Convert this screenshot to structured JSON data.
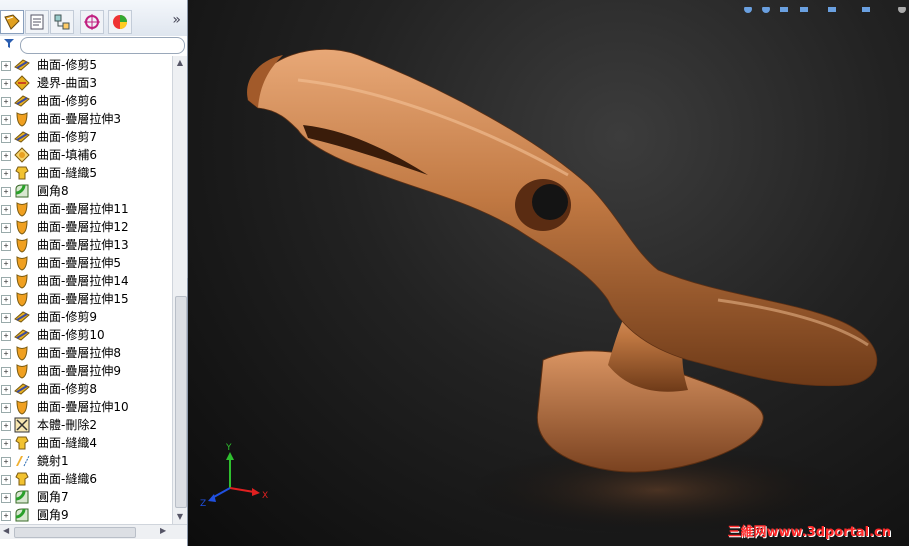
{
  "panel": {
    "tabs": [
      {
        "icon": "feature-manager-icon",
        "active": true
      },
      {
        "icon": "property-manager-icon"
      },
      {
        "icon": "configuration-manager-icon"
      },
      {
        "icon": "dimxpert-icon"
      },
      {
        "icon": "display-manager-icon"
      }
    ],
    "more_label": "»",
    "filter_icon": "filter-icon"
  },
  "tree": {
    "items": [
      {
        "label": "曲面-修剪5",
        "icon": "trim-surface-icon"
      },
      {
        "label": "邊界-曲面3",
        "icon": "boundary-surface-icon"
      },
      {
        "label": "曲面-修剪6",
        "icon": "trim-surface-icon"
      },
      {
        "label": "曲面-疊層拉伸3",
        "icon": "loft-surface-icon"
      },
      {
        "label": "曲面-修剪7",
        "icon": "trim-surface-icon"
      },
      {
        "label": "曲面-填補6",
        "icon": "fill-surface-icon"
      },
      {
        "label": "曲面-縫織5",
        "icon": "knit-surface-icon"
      },
      {
        "label": "圓角8",
        "icon": "fillet-icon"
      },
      {
        "label": "曲面-疊層拉伸11",
        "icon": "loft-surface-icon"
      },
      {
        "label": "曲面-疊層拉伸12",
        "icon": "loft-surface-icon"
      },
      {
        "label": "曲面-疊層拉伸13",
        "icon": "loft-surface-icon"
      },
      {
        "label": "曲面-疊層拉伸5",
        "icon": "loft-surface-icon"
      },
      {
        "label": "曲面-疊層拉伸14",
        "icon": "loft-surface-icon"
      },
      {
        "label": "曲面-疊層拉伸15",
        "icon": "loft-surface-icon"
      },
      {
        "label": "曲面-修剪9",
        "icon": "trim-surface-icon"
      },
      {
        "label": "曲面-修剪10",
        "icon": "trim-surface-icon"
      },
      {
        "label": "曲面-疊層拉伸8",
        "icon": "loft-surface-icon"
      },
      {
        "label": "曲面-疊層拉伸9",
        "icon": "loft-surface-icon"
      },
      {
        "label": "曲面-修剪8",
        "icon": "trim-surface-icon"
      },
      {
        "label": "曲面-疊層拉伸10",
        "icon": "loft-surface-icon"
      },
      {
        "label": "本體-刪除2",
        "icon": "delete-body-icon"
      },
      {
        "label": "曲面-縫織4",
        "icon": "knit-surface-icon"
      },
      {
        "label": "鏡射1",
        "icon": "mirror-icon"
      },
      {
        "label": "曲面-縫織6",
        "icon": "knit-surface-icon"
      },
      {
        "label": "圓角7",
        "icon": "fillet-icon"
      },
      {
        "label": "圓角9",
        "icon": "fillet-icon"
      }
    ]
  },
  "viewport": {
    "model": "toucan-shaped surface model",
    "axis_labels": {
      "x": "X",
      "y": "Y",
      "z": "Z"
    },
    "watermark": "三維网www.3dportal.cn"
  },
  "colors": {
    "model": "#b86a3a",
    "model_highlight": "#e3a06d",
    "background": "#1c1c1c",
    "watermark": "#ff2a2a"
  }
}
